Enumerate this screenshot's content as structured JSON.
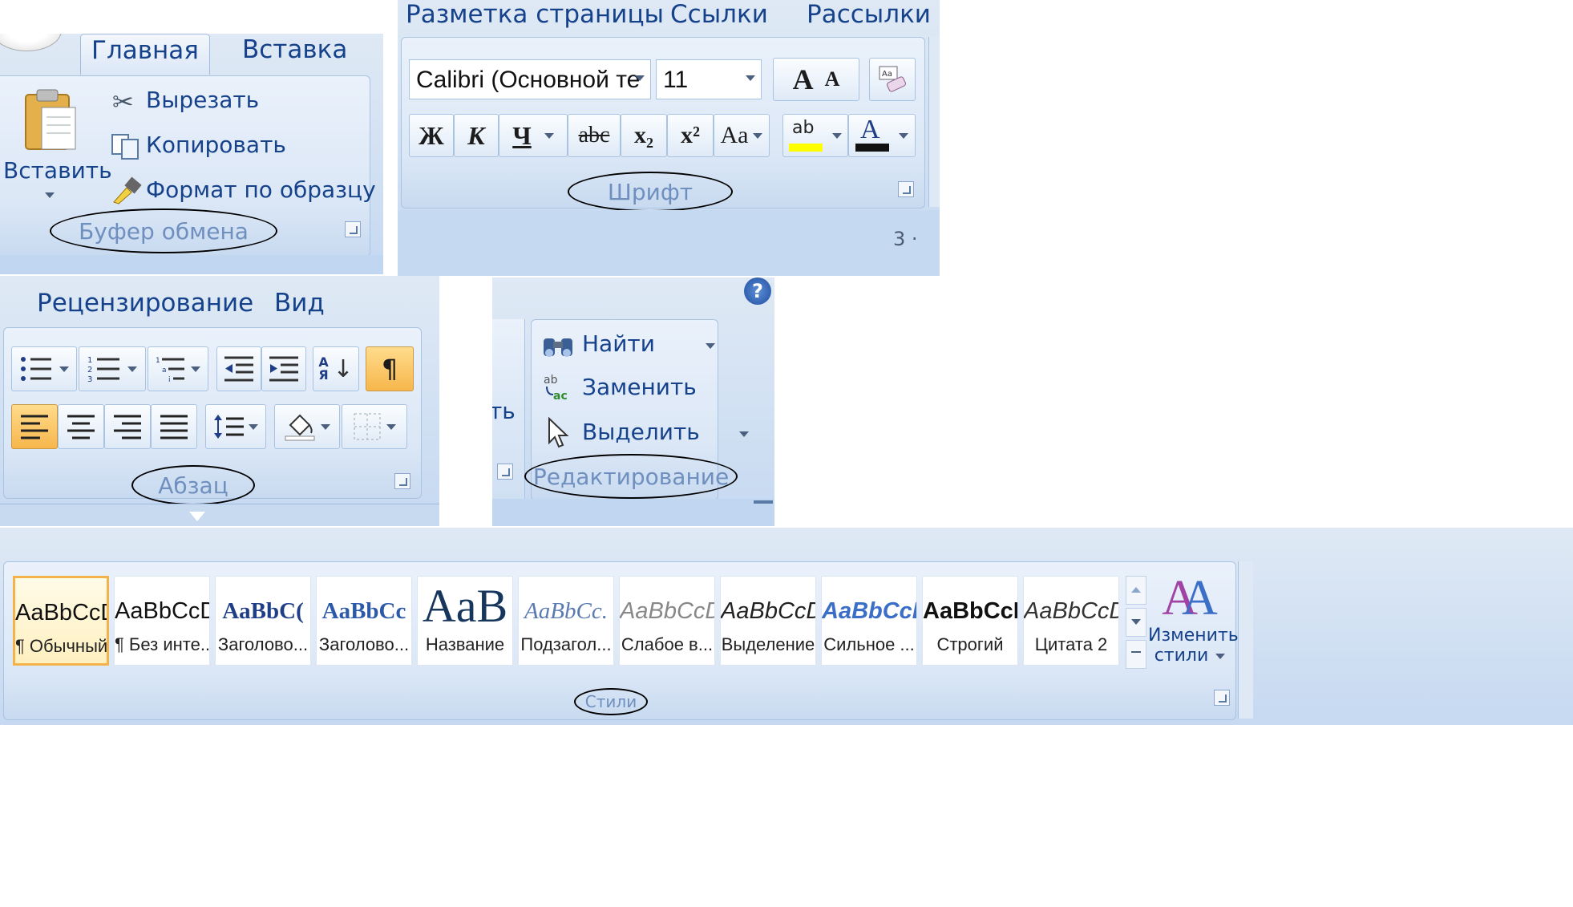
{
  "clipboard": {
    "tabs": [
      "Главная",
      "Вставка"
    ],
    "paste_label": "Вставить",
    "cut_label": "Вырезать",
    "copy_label": "Копировать",
    "format_painter_label": "Формат по образцу",
    "group_label": "Буфер обмена"
  },
  "font": {
    "tabs": [
      "Разметка страницы",
      "Ссылки",
      "Рассылки"
    ],
    "font_name": "Calibri (Основной те",
    "font_size": "11",
    "bold": "Ж",
    "italic": "К",
    "underline": "Ч",
    "strike": "abc",
    "subscript": "x₂",
    "superscript": "x²",
    "change_case": "Aa",
    "grow": "A",
    "shrink": "A",
    "highlight": "ab",
    "font_color": "A",
    "group_label": "Шрифт",
    "status_fragment": "3 ·"
  },
  "paragraph": {
    "tabs": [
      "Рецензирование",
      "Вид"
    ],
    "sort_glyph": "АЯ",
    "pilcrow": "¶",
    "group_label": "Абзац"
  },
  "editing": {
    "find_label": "Найти",
    "replace_label": "Заменить",
    "select_label": "Выделить",
    "group_label": "Редактирование",
    "clipped_text": "ть",
    "help_glyph": "?"
  },
  "styles": {
    "items": [
      {
        "sample": "AaBbCcDc",
        "name": "¶ Обычный",
        "selected": true
      },
      {
        "sample": "AaBbCcDc",
        "name": "¶ Без инте...",
        "selected": false
      },
      {
        "sample": "AaBbC(",
        "name": "Заголово...",
        "selected": false
      },
      {
        "sample": "AaBbCc",
        "name": "Заголово...",
        "selected": false
      },
      {
        "sample": "AaB",
        "name": "Название",
        "selected": false
      },
      {
        "sample": "AaBbCc.",
        "name": "Подзагол...",
        "selected": false
      },
      {
        "sample": "AaBbCcDı",
        "name": "Слабое в...",
        "selected": false
      },
      {
        "sample": "AaBbCcDı",
        "name": "Выделение",
        "selected": false
      },
      {
        "sample": "AaBbCcDı",
        "name": "Сильное ...",
        "selected": false
      },
      {
        "sample": "AaBbCcDc",
        "name": "Строгий",
        "selected": false
      },
      {
        "sample": "AaBbCcDı",
        "name": "Цитата 2",
        "selected": false
      }
    ],
    "change_styles_line1": "Изменить",
    "change_styles_line2": "стили",
    "group_label": "Стили"
  },
  "colors": {
    "ribbon_text": "#15428b",
    "selected_button": "#f7b64c",
    "highlight_yellow": "#ffff00",
    "font_color_red": "#c00000",
    "ellipse_outline": "#000000"
  }
}
